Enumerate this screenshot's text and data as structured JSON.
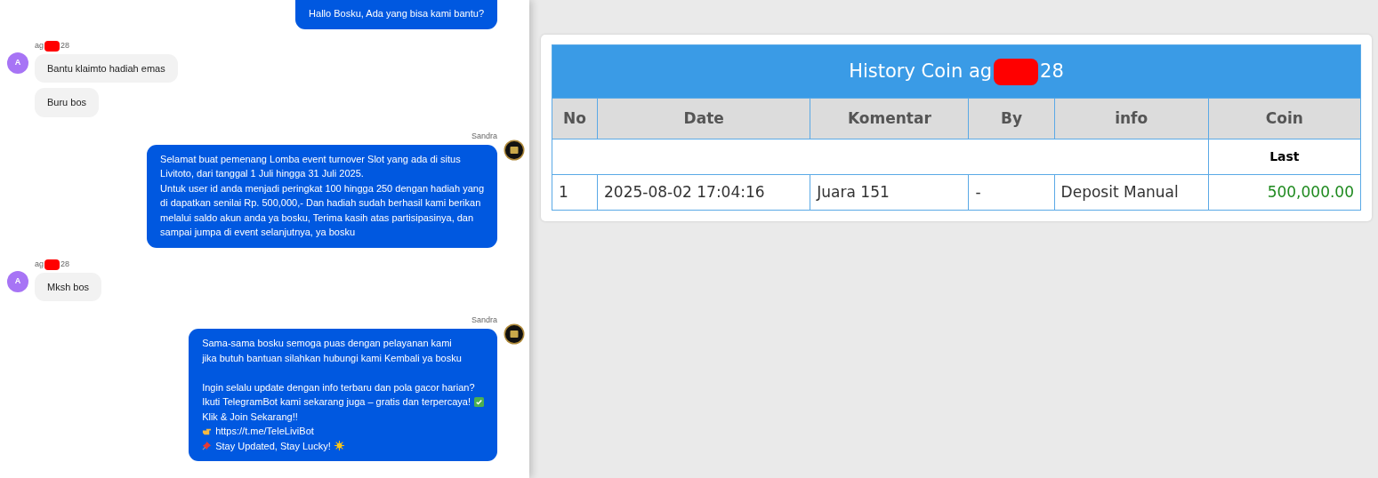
{
  "chat": {
    "groups": [
      {
        "kind": "agent",
        "avatar": false,
        "bubbles": [
          {
            "paragraphs": [
              [
                {
                  "text": "Hallo Bosku, Ada yang bisa kami bantu?"
                }
              ]
            ]
          }
        ]
      },
      {
        "kind": "user",
        "sender": {
          "prefix": "ag",
          "suffix": "28",
          "redacted": true
        },
        "avatar_letter": "A",
        "bubbles": [
          {
            "paragraphs": [
              [
                {
                  "text": "Bantu klaimto hadiah emas"
                }
              ]
            ]
          },
          {
            "paragraphs": [
              [
                {
                  "text": "Buru bos"
                }
              ]
            ]
          }
        ]
      },
      {
        "kind": "agent",
        "sender": {
          "prefix": "Sandra"
        },
        "avatar": true,
        "bubbles": [
          {
            "paragraphs": [
              [
                {
                  "text": "Selamat buat pemenang Lomba event turnover Slot yang ada di situs"
                },
                {
                  "text": "Livitoto, dari tanggal 1 Juli hingga 31 Juli 2025."
                },
                {
                  "text": "Untuk user id anda menjadi peringkat 100 hingga 250 dengan hadiah yang"
                },
                {
                  "text": "di dapatkan senilai Rp. 500,000,- Dan hadiah sudah berhasil kami berikan"
                },
                {
                  "text": "melalui saldo akun anda ya bosku, Terima kasih atas partisipasinya, dan"
                },
                {
                  "text": "sampai jumpa di event selanjutnya, ya bosku"
                }
              ]
            ]
          }
        ]
      },
      {
        "kind": "user",
        "sender": {
          "prefix": "ag",
          "suffix": "28",
          "redacted": true
        },
        "avatar_letter": "A",
        "bubbles": [
          {
            "paragraphs": [
              [
                {
                  "text": "Mksh bos"
                }
              ]
            ]
          }
        ]
      },
      {
        "kind": "agent",
        "sender": {
          "prefix": "Sandra"
        },
        "avatar": true,
        "bubbles": [
          {
            "paragraphs": [
              [
                {
                  "text": "Sama-sama bosku semoga puas dengan pelayanan kami"
                },
                {
                  "text": "jika butuh bantuan silahkan hubungi kami Kembali ya bosku"
                }
              ],
              [
                {
                  "text": "Ingin selalu update dengan info terbaru dan pola gacor harian?"
                },
                {
                  "text": "Ikuti TelegramBot kami sekarang juga – gratis dan terpercaya!",
                  "trailing_icon": {
                    "kind": "check"
                  }
                },
                {
                  "text": "Klik & Join Sekarang!!"
                },
                {
                  "text": "https://t.me/TeleLiviBot",
                  "leading_icon": {
                    "kind": "pointing-hand"
                  }
                },
                {
                  "text": "Stay Updated, Stay Lucky!",
                  "leading_icon": {
                    "kind": "pin"
                  },
                  "trailing_icon": {
                    "kind": "sun"
                  }
                }
              ]
            ]
          }
        ]
      }
    ]
  },
  "history": {
    "title": {
      "prefix": "History Coin ag",
      "suffix": "28",
      "redacted": true
    },
    "columns": [
      "No",
      "Date",
      "Komentar",
      "By",
      "info",
      "Coin"
    ],
    "summary": {
      "label": "Last"
    },
    "rows": [
      {
        "cells": [
          "1",
          "2025-08-02 17:04:16",
          "Juara 151",
          "-",
          "Deposit Manual",
          "500,000.00"
        ]
      }
    ]
  }
}
